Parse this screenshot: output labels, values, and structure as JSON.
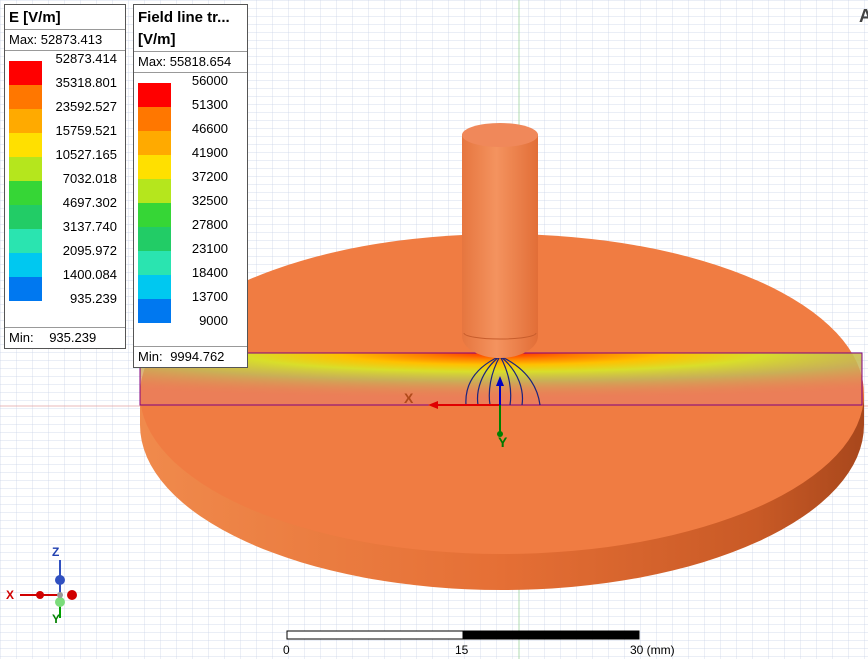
{
  "legend_e": {
    "title": "E [V/m]",
    "max_label": "Max: 52873.413",
    "min_label": "Min:",
    "min_value": "935.239",
    "values": [
      "52873.414",
      "35318.801",
      "23592.527",
      "15759.521",
      "10527.165",
      "7032.018",
      "4697.302",
      "3137.740",
      "2095.972",
      "1400.084",
      "935.239"
    ]
  },
  "legend_field": {
    "title_line1": "Field line tr...",
    "title_line2": "[V/m]",
    "max_label": "Max: 55818.654",
    "min_label": "Min:",
    "min_value": "9994.762",
    "values": [
      "56000",
      "51300",
      "46600",
      "41900",
      "37200",
      "32500",
      "27800",
      "23100",
      "18400",
      "13700",
      "9000"
    ]
  },
  "scale_bar": {
    "tick0": "0",
    "tick1": "15",
    "tick2": "30 (mm)"
  },
  "triad": {
    "z": "Z",
    "x": "X",
    "y": "Y"
  },
  "origin_axes": {
    "x": "X",
    "y": "Y"
  },
  "corner_letter": "A",
  "colors": {
    "map": [
      "#ff0000",
      "#ff7700",
      "#ffaa00",
      "#ffe000",
      "#b5e61d",
      "#36d636",
      "#22cc66",
      "#2ae4b0",
      "#00c8f0",
      "#0078f0",
      "#0020f0"
    ],
    "body_orange": "#f07a40",
    "cylinder_orange": "#ef8550",
    "slice_outline": "#800080",
    "field_line": "#1a237e"
  }
}
